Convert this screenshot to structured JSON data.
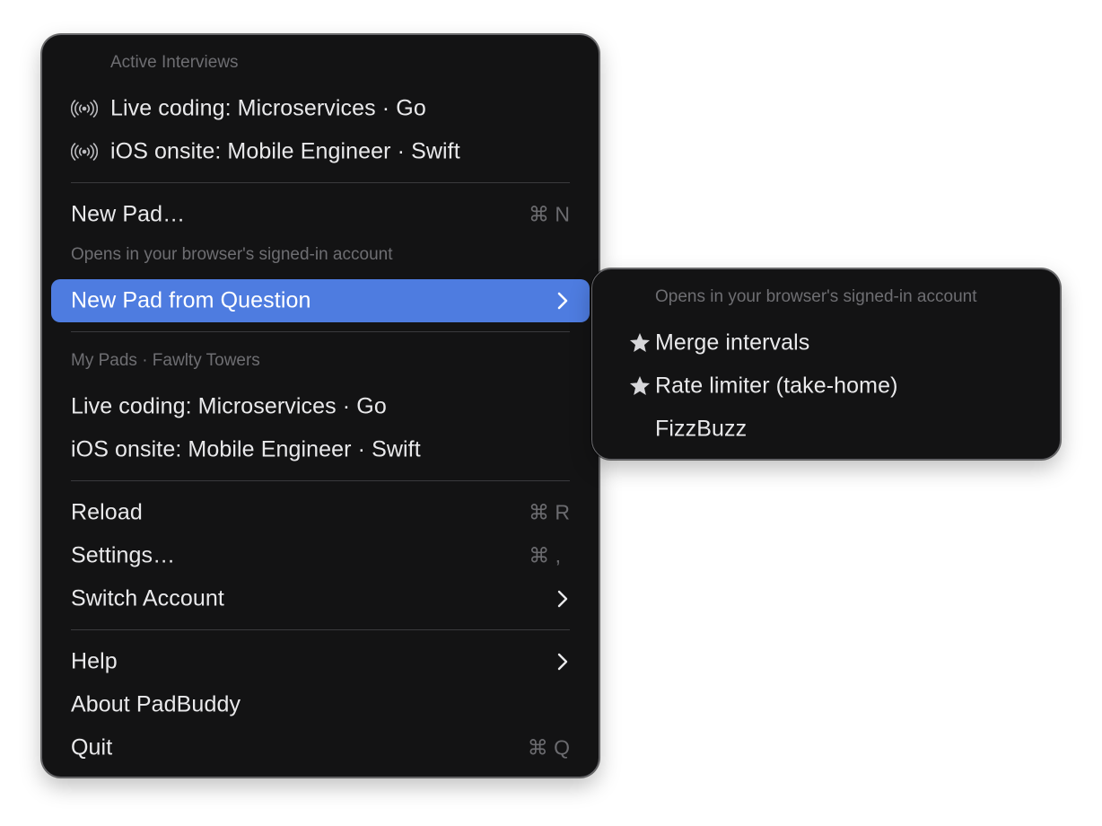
{
  "colors": {
    "menu_bg": "#131314",
    "highlight": "#4e7ce0",
    "text": "#e9e9eb",
    "secondary_text": "#6e6e72"
  },
  "main_menu": {
    "active_header": "Active Interviews",
    "active_items": [
      {
        "label": "Live coding: Microservices · Go",
        "icon": "broadcast-icon"
      },
      {
        "label": "iOS onsite: Mobile Engineer · Swift",
        "icon": "broadcast-icon"
      }
    ],
    "new_pad": {
      "label": "New Pad…",
      "shortcut": "⌘ N"
    },
    "new_pad_note": "Opens in your browser's signed-in account",
    "new_pad_from_question": {
      "label": "New Pad from Question",
      "icon": "chevron-right-icon",
      "highlighted": true
    },
    "my_pads_header": "My Pads · Fawlty Towers",
    "my_pads": [
      {
        "label": "Live coding: Microservices · Go"
      },
      {
        "label": "iOS onsite: Mobile Engineer · Swift"
      }
    ],
    "reload": {
      "label": "Reload",
      "shortcut": "⌘ R"
    },
    "settings": {
      "label": "Settings…",
      "shortcut": "⌘ ,"
    },
    "switch_account": {
      "label": "Switch Account",
      "icon": "chevron-right-icon"
    },
    "help": {
      "label": "Help",
      "icon": "chevron-right-icon"
    },
    "about": {
      "label": "About PadBuddy"
    },
    "quit": {
      "label": "Quit",
      "shortcut": "⌘ Q"
    }
  },
  "submenu": {
    "header": "Opens in your browser's signed-in account",
    "items": [
      {
        "label": "Merge intervals",
        "starred": true,
        "icon": "star-icon"
      },
      {
        "label": "Rate limiter (take-home)",
        "starred": true,
        "icon": "star-icon"
      },
      {
        "label": "FizzBuzz",
        "starred": false
      }
    ]
  }
}
